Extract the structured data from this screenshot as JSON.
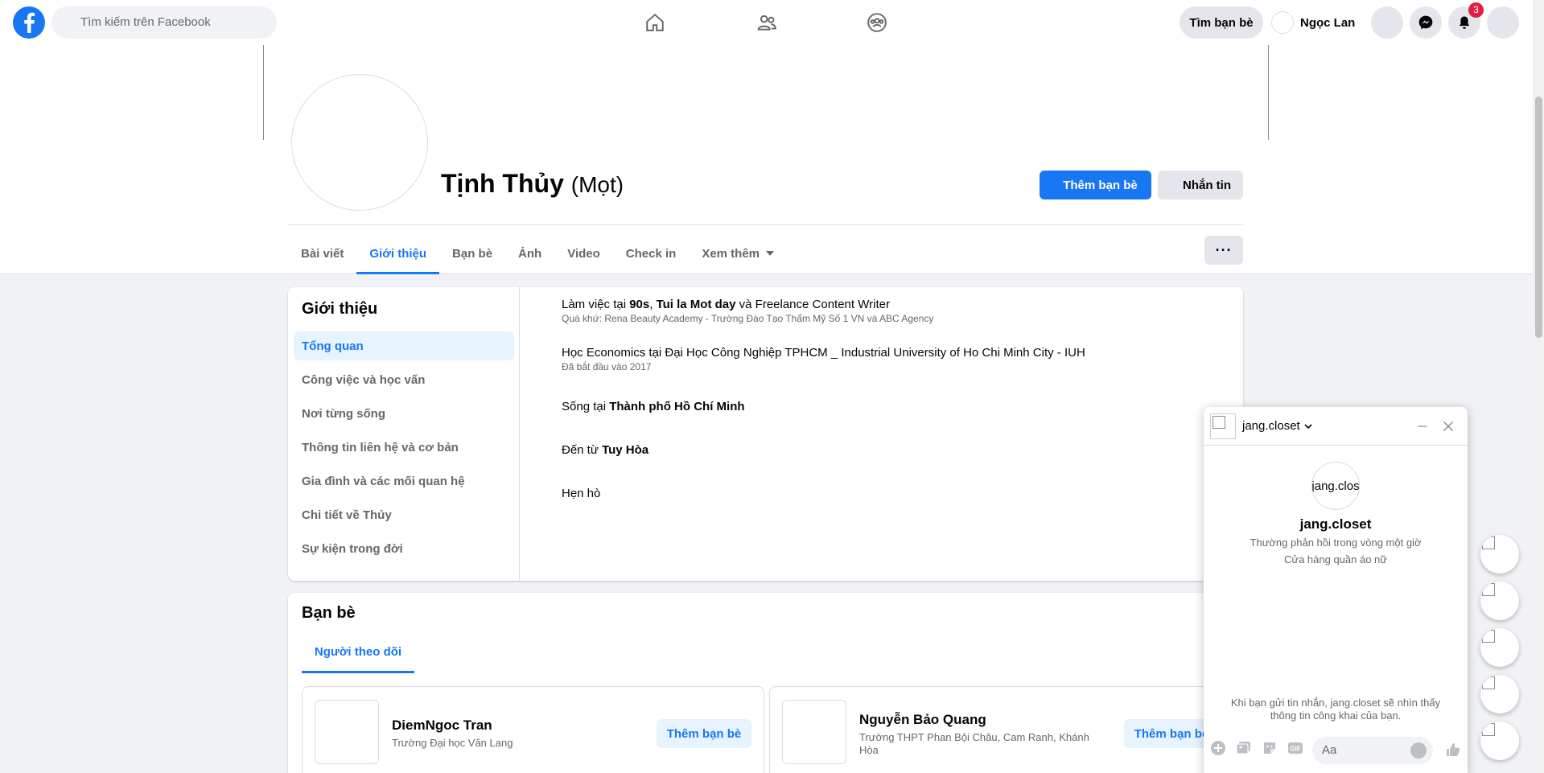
{
  "topbar": {
    "search_placeholder": "Tìm kiếm trên Facebook",
    "find_friends": "Tìm bạn bè",
    "user_name": "Ngọc Lan",
    "notification_count": "3",
    "brand_color": "#1877f2"
  },
  "profile": {
    "name": "Tịnh Thủy",
    "nickname": "(Mọt)",
    "add_friend": "Thêm bạn bè",
    "message": "Nhắn tin"
  },
  "tabs": [
    "Bài viết",
    "Giới thiệu",
    "Bạn bè",
    "Ảnh",
    "Video",
    "Check in",
    "Xem thêm"
  ],
  "about": {
    "title": "Giới thiệu",
    "menu": [
      "Tổng quan",
      "Công việc và học vấn",
      "Nơi từng sống",
      "Thông tin liên hệ và cơ bản",
      "Gia đình và các mối quan hệ",
      "Chi tiết về Thủy",
      "Sự kiện trong đời"
    ],
    "work": {
      "prefix": "Làm việc tại ",
      "place1": "90s",
      "sep": ", ",
      "place2": "Tui la Mot day",
      "suffix": " và Freelance Content Writer",
      "past": "Quá khứ: Rena Beauty Academy - Trường Đào Tạo Thẩm Mỹ Số 1 VN và ABC Agency"
    },
    "education": {
      "text": "Học Economics tại Đại Học Công Nghiệp TPHCM _ Industrial University of Ho Chi Minh City - IUH",
      "since": "Đã bắt đầu vào 2017"
    },
    "lives": {
      "prefix": "Sống tại ",
      "place": "Thành phố Hồ Chí Minh"
    },
    "from": {
      "prefix": "Đến từ ",
      "place": "Tuy Hòa"
    },
    "dating": "Hẹn hò"
  },
  "friends": {
    "title": "Bạn bè",
    "tab": "Người theo dõi",
    "items": [
      {
        "name": "DiemNgoc Tran",
        "sub": "Trường Đại học Văn Lang",
        "action": "Thêm bạn bè"
      },
      {
        "name": "Nguyễn Bảo Quang",
        "sub": "Trường THPT Phan Bội Châu, Cam Ranh, Khánh Hòa",
        "action": "Thêm bạn bè"
      }
    ]
  },
  "chat": {
    "name": "jang.closet",
    "avatar_alt": "jang.clos",
    "response": "Thường phản hồi trong vòng một giờ",
    "category": "Cửa hàng quần áo nữ",
    "notice": "Khi bạn gửi tin nhắn, jang.closet sẽ nhìn thấy thông tin công khai của bạn.",
    "input_placeholder": "Aa",
    "gif_label": "GIF"
  }
}
